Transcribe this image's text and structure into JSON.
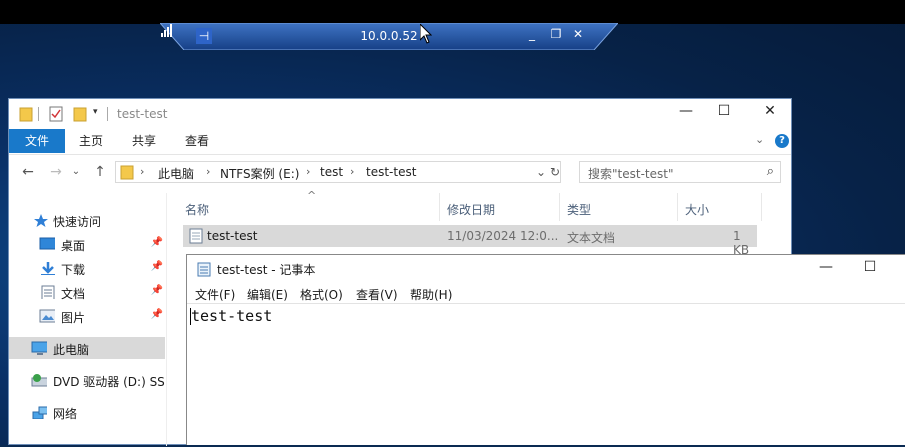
{
  "remote_bar": {
    "pin_glyph": "⊣",
    "host": "10.0.0.52",
    "minimize": "_",
    "restore": "❐",
    "close": "✕"
  },
  "explorer": {
    "title": "test-test",
    "window_controls": {
      "minimize": "—",
      "maximize": "☐",
      "close": "✕"
    },
    "ribbon": {
      "file_tab": "文件",
      "tabs": [
        "主页",
        "共享",
        "查看"
      ],
      "expand": "⌄",
      "help": "?"
    },
    "nav": {
      "back": "←",
      "forward": "→",
      "recent": "⌄",
      "up": "↑",
      "breadcrumbs": [
        "此电脑",
        "NTFS案例 (E:)",
        "test",
        "test-test"
      ],
      "dropdown": "⌄",
      "refresh": "↻",
      "search_placeholder": "搜索\"test-test\"",
      "search_icon": "⌕"
    },
    "sidebar": [
      {
        "label": "快速访问",
        "icon": "star-icon",
        "pinned": false
      },
      {
        "label": "桌面",
        "icon": "desktop-icon",
        "pinned": true
      },
      {
        "label": "下载",
        "icon": "download-icon",
        "pinned": true
      },
      {
        "label": "文档",
        "icon": "document-icon",
        "pinned": true
      },
      {
        "label": "图片",
        "icon": "picture-icon",
        "pinned": true
      },
      {
        "label": "此电脑",
        "icon": "computer-icon",
        "pinned": false,
        "selected": true
      },
      {
        "label": "DVD 驱动器 (D:) SSS",
        "icon": "dvd-icon",
        "pinned": false
      },
      {
        "label": "网络",
        "icon": "network-icon",
        "pinned": false
      }
    ],
    "pin_glyph": "📌",
    "columns": {
      "name": "名称",
      "date": "修改日期",
      "type": "类型",
      "size": "大小",
      "sort_glyph": "^"
    },
    "files": [
      {
        "name": "test-test",
        "date": "11/03/2024 12:0...",
        "type": "文本文档",
        "size": "1 KB"
      }
    ]
  },
  "notepad": {
    "title": "test-test - 记事本",
    "window_controls": {
      "minimize": "—",
      "maximize": "☐"
    },
    "menu": [
      "文件(F)",
      "编辑(E)",
      "格式(O)",
      "查看(V)",
      "帮助(H)"
    ],
    "content": "test-test"
  },
  "colors": {
    "accent": "#1979ca",
    "selection": "#d9d9d9",
    "remote_bar": "#1e4f9e"
  }
}
